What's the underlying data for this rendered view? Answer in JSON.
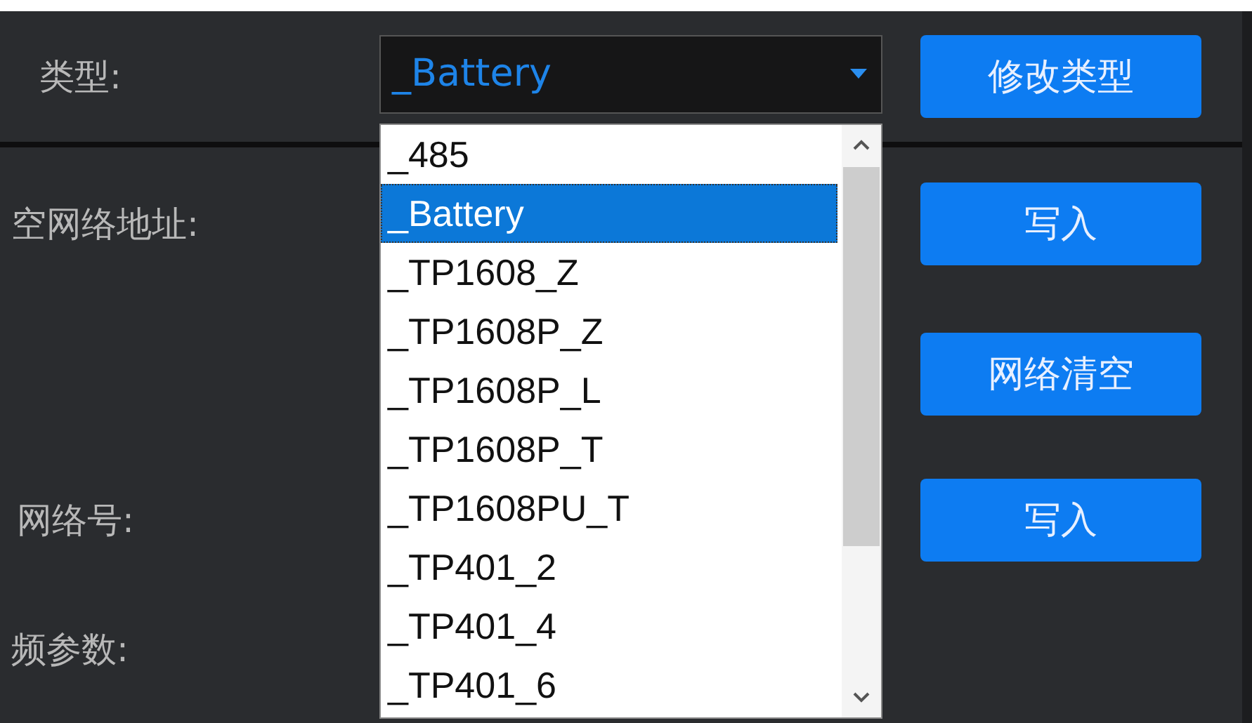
{
  "type_row": {
    "label": "类型:",
    "value": "_Battery",
    "button": "修改类型"
  },
  "dropdown": {
    "items": [
      {
        "label": "_485",
        "selected": false
      },
      {
        "label": "_Battery",
        "selected": true
      },
      {
        "label": "_TP1608_Z",
        "selected": false
      },
      {
        "label": "_TP1608P_Z",
        "selected": false
      },
      {
        "label": "_TP1608P_L",
        "selected": false
      },
      {
        "label": "_TP1608P_T",
        "selected": false
      },
      {
        "label": "_TP1608PU_T",
        "selected": false
      },
      {
        "label": "_TP401_2",
        "selected": false
      },
      {
        "label": "_TP401_4",
        "selected": false
      },
      {
        "label": "_TP401_6",
        "selected": false
      }
    ]
  },
  "rows": [
    {
      "label": "空网络地址:",
      "button": "写入"
    },
    {
      "button": "网络清空"
    },
    {
      "label": "网络号:",
      "button": "写入"
    },
    {
      "label": "频参数:"
    }
  ]
}
